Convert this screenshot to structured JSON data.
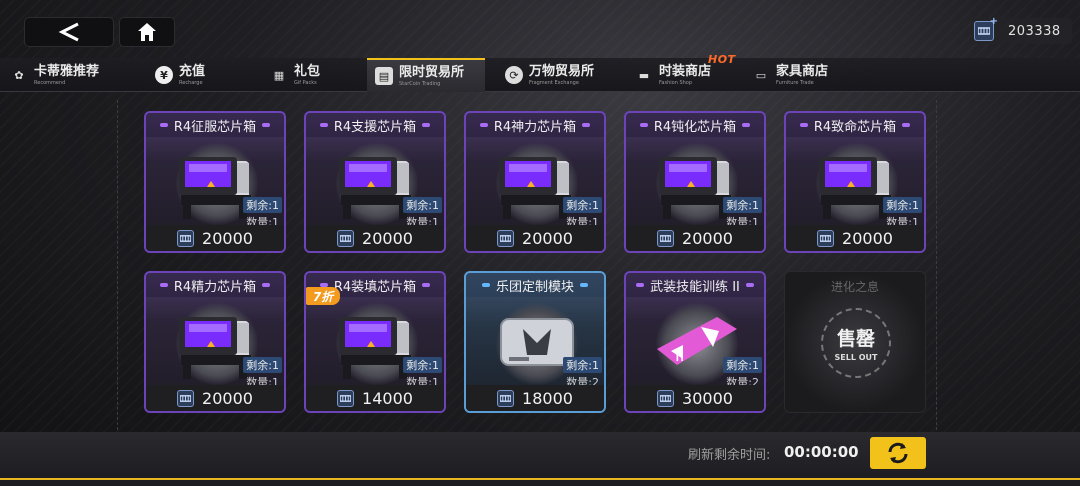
{
  "header": {
    "currency_value": "203338"
  },
  "tabs": [
    {
      "name": "卡蒂雅推荐",
      "sub": "Recommend",
      "icon": "rabbit-icon"
    },
    {
      "name": "充值",
      "sub": "Recharge",
      "icon": "yen-icon"
    },
    {
      "name": "礼包",
      "sub": "Gif Packs",
      "icon": "gift-icon"
    },
    {
      "name": "限时贸易所",
      "sub": "StarCoin Trading",
      "icon": "trade-icon"
    },
    {
      "name": "万物贸易所",
      "sub": "Fragment Exchange",
      "icon": "exchange-icon"
    },
    {
      "name": "时装商店",
      "sub": "Fashion Shop",
      "icon": "fashion-icon"
    },
    {
      "name": "家具商店",
      "sub": "Furniture Trade",
      "icon": "sofa-icon"
    }
  ],
  "hot_badge": "HOT",
  "items": [
    {
      "title": "R4征服芯片箱",
      "remaining": "剩余:1",
      "quantity": "数量:1",
      "price": "20000"
    },
    {
      "title": "R4支援芯片箱",
      "remaining": "剩余:1",
      "quantity": "数量:1",
      "price": "20000"
    },
    {
      "title": "R4神力芯片箱",
      "remaining": "剩余:1",
      "quantity": "数量:1",
      "price": "20000"
    },
    {
      "title": "R4钝化芯片箱",
      "remaining": "剩余:1",
      "quantity": "数量:1",
      "price": "20000"
    },
    {
      "title": "R4致命芯片箱",
      "remaining": "剩余:1",
      "quantity": "数量:1",
      "price": "20000"
    },
    {
      "title": "R4精力芯片箱",
      "remaining": "剩余:1",
      "quantity": "数量:1",
      "price": "20000"
    },
    {
      "title": "R4装填芯片箱",
      "remaining": "剩余:1",
      "quantity": "数量:1",
      "price": "14000",
      "discount": "7折"
    },
    {
      "title": "乐团定制模块",
      "remaining": "剩余:1",
      "quantity": "数量:2",
      "price": "18000"
    },
    {
      "title": "武装技能训练 II",
      "remaining": "剩余:1",
      "quantity": "数量:2",
      "price": "30000"
    }
  ],
  "sold_out": {
    "title": "进化之息",
    "stamp_cn": "售罄",
    "stamp_en": "SELL OUT"
  },
  "footer": {
    "refresh_label": "刷新剩余时间:",
    "refresh_time": "00:00:00"
  }
}
